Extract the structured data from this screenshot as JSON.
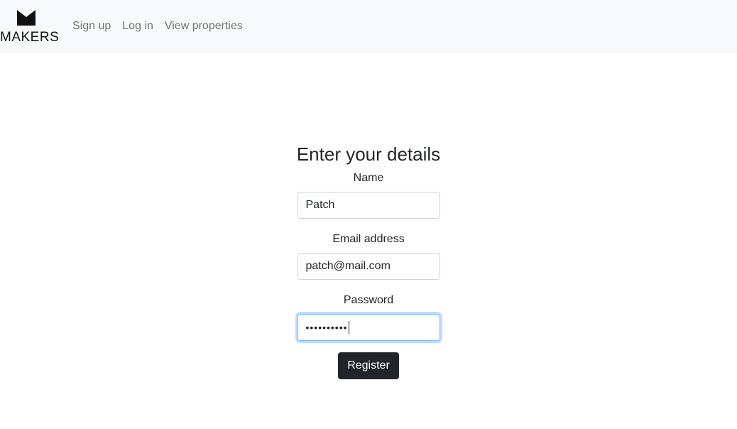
{
  "brand": {
    "logo_icon": "makers-m-icon",
    "name": "MAKERS"
  },
  "nav": {
    "items": [
      {
        "label": "Sign up"
      },
      {
        "label": "Log in"
      },
      {
        "label": "View properties"
      }
    ]
  },
  "form": {
    "title": "Enter your details",
    "name": {
      "label": "Name",
      "value": "Patch"
    },
    "email": {
      "label": "Email address",
      "value": "patch@mail.com"
    },
    "password": {
      "label": "Password",
      "masked": "••••••••••"
    },
    "submit_label": "Register"
  },
  "colors": {
    "navbar_bg": "#f8f9fa",
    "button_bg": "#212529",
    "focus_ring": "#86b7fe"
  }
}
